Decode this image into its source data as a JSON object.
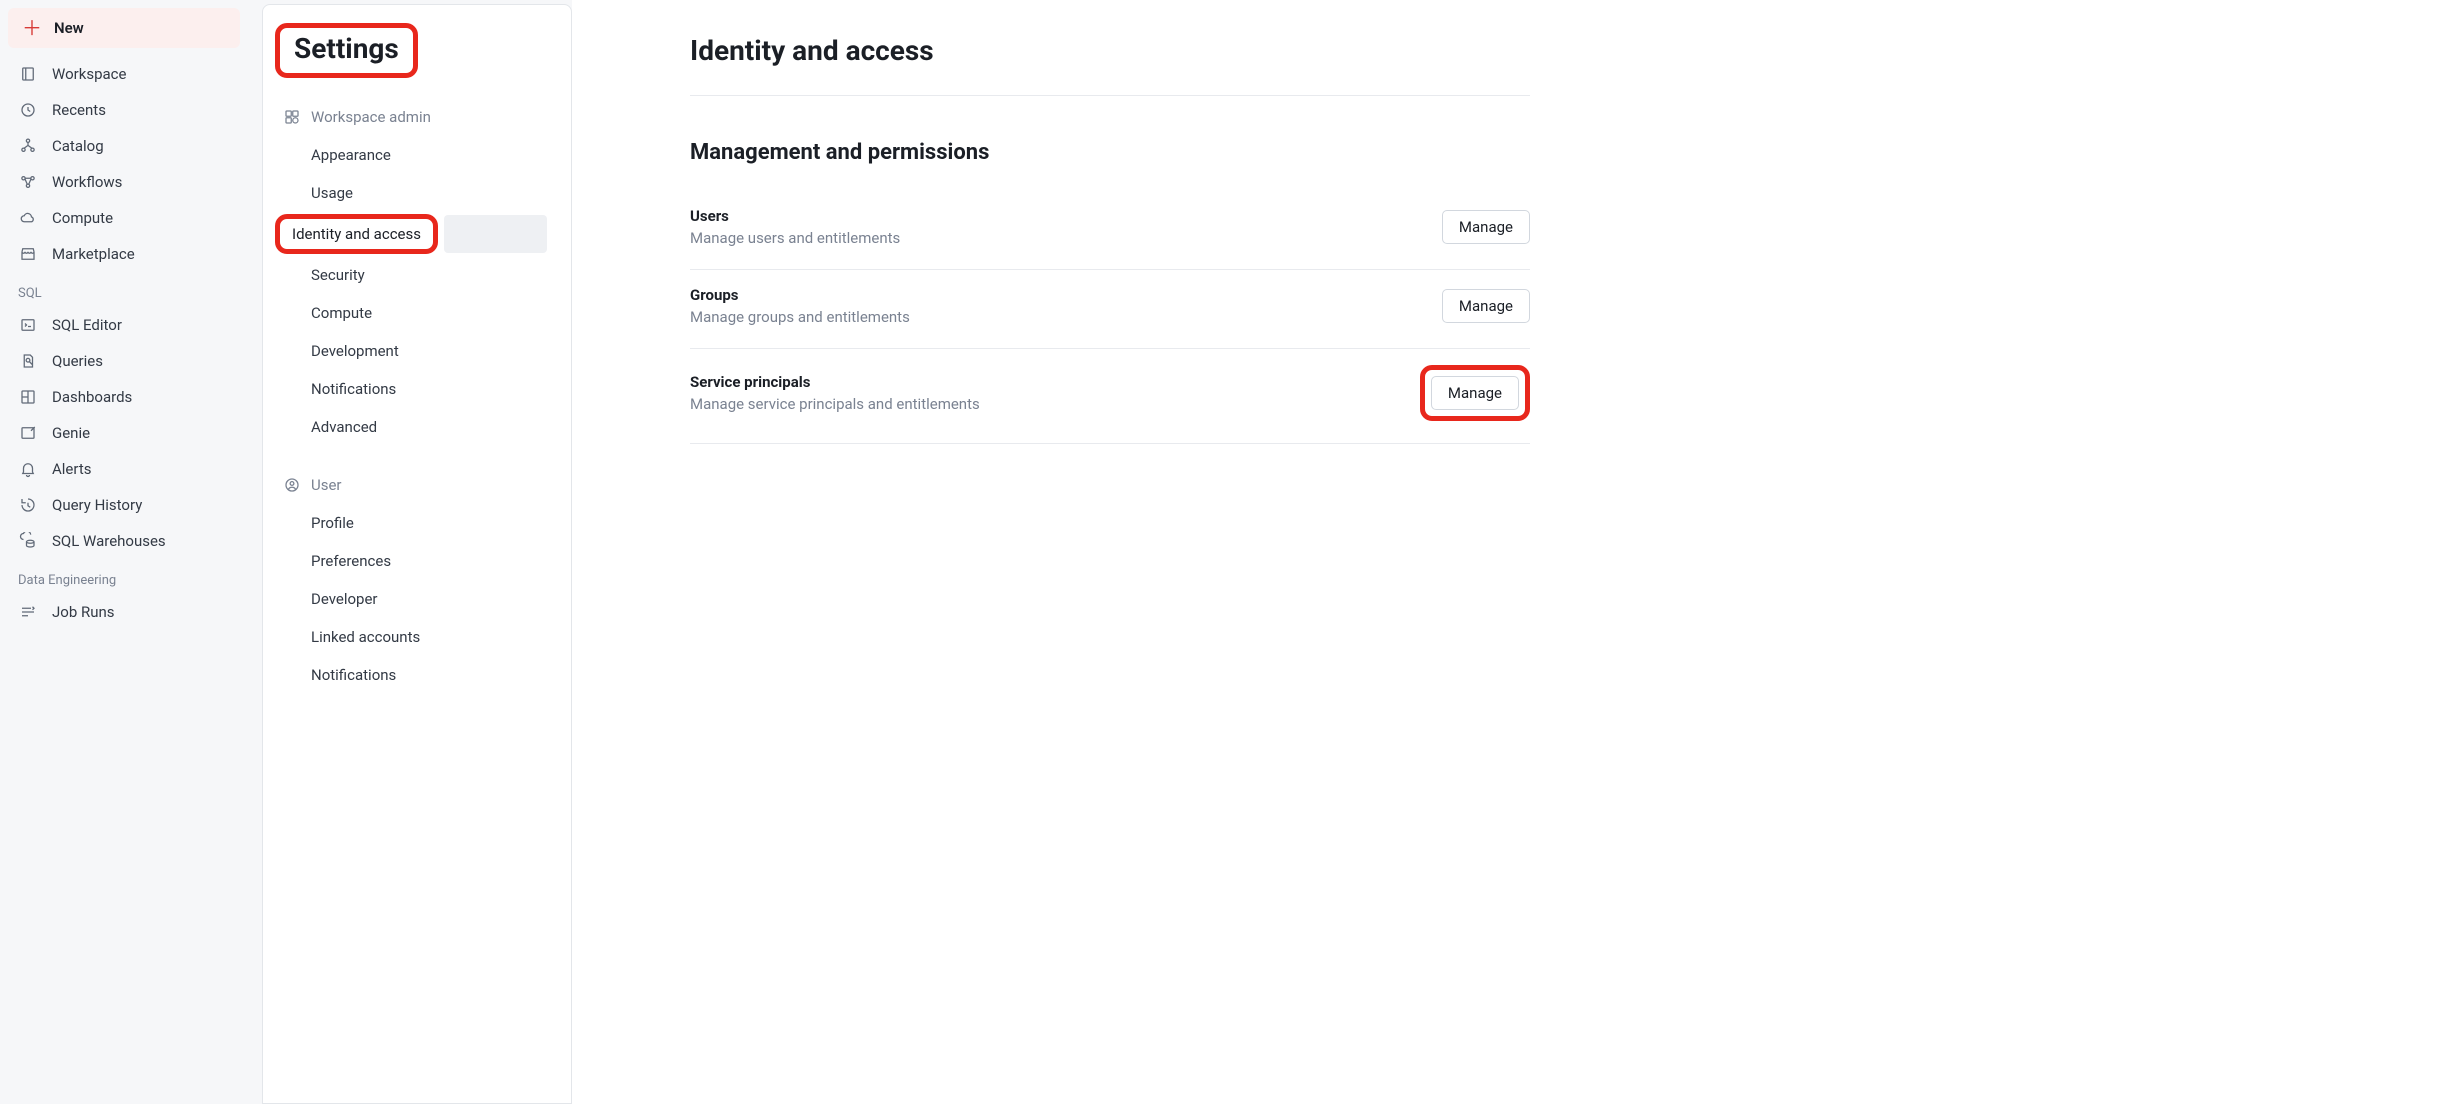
{
  "new_button": {
    "label": "New"
  },
  "nav": {
    "main": [
      {
        "label": "Workspace",
        "icon": "folder-icon"
      },
      {
        "label": "Recents",
        "icon": "clock-icon"
      },
      {
        "label": "Catalog",
        "icon": "hierarchy-icon"
      },
      {
        "label": "Workflows",
        "icon": "workflow-icon"
      },
      {
        "label": "Compute",
        "icon": "cloud-icon"
      },
      {
        "label": "Marketplace",
        "icon": "store-icon"
      }
    ],
    "sections": [
      {
        "label": "SQL",
        "items": [
          {
            "label": "SQL Editor",
            "icon": "terminal-icon"
          },
          {
            "label": "Queries",
            "icon": "query-icon"
          },
          {
            "label": "Dashboards",
            "icon": "dashboard-icon"
          },
          {
            "label": "Genie",
            "icon": "genie-icon"
          },
          {
            "label": "Alerts",
            "icon": "bell-icon"
          },
          {
            "label": "Query History",
            "icon": "history-icon"
          },
          {
            "label": "SQL Warehouses",
            "icon": "warehouse-icon"
          }
        ]
      },
      {
        "label": "Data Engineering",
        "items": [
          {
            "label": "Job Runs",
            "icon": "jobruns-icon"
          }
        ]
      }
    ]
  },
  "settings": {
    "title": "Settings",
    "groups": [
      {
        "label": "Workspace admin",
        "icon": "admin-icon",
        "items": [
          {
            "label": "Appearance"
          },
          {
            "label": "Usage"
          },
          {
            "label": "Identity and access",
            "active": true,
            "highlighted": true
          },
          {
            "label": "Security"
          },
          {
            "label": "Compute"
          },
          {
            "label": "Development"
          },
          {
            "label": "Notifications"
          },
          {
            "label": "Advanced"
          }
        ]
      },
      {
        "label": "User",
        "icon": "user-icon",
        "items": [
          {
            "label": "Profile"
          },
          {
            "label": "Preferences"
          },
          {
            "label": "Developer"
          },
          {
            "label": "Linked accounts"
          },
          {
            "label": "Notifications"
          }
        ]
      }
    ]
  },
  "main": {
    "title": "Identity and access",
    "subtitle": "Management and permissions",
    "rows": [
      {
        "label": "Users",
        "desc": "Manage users and entitlements",
        "button": "Manage"
      },
      {
        "label": "Groups",
        "desc": "Manage groups and entitlements",
        "button": "Manage"
      },
      {
        "label": "Service principals",
        "desc": "Manage service principals and entitlements",
        "button": "Manage",
        "highlighted": true
      }
    ]
  }
}
